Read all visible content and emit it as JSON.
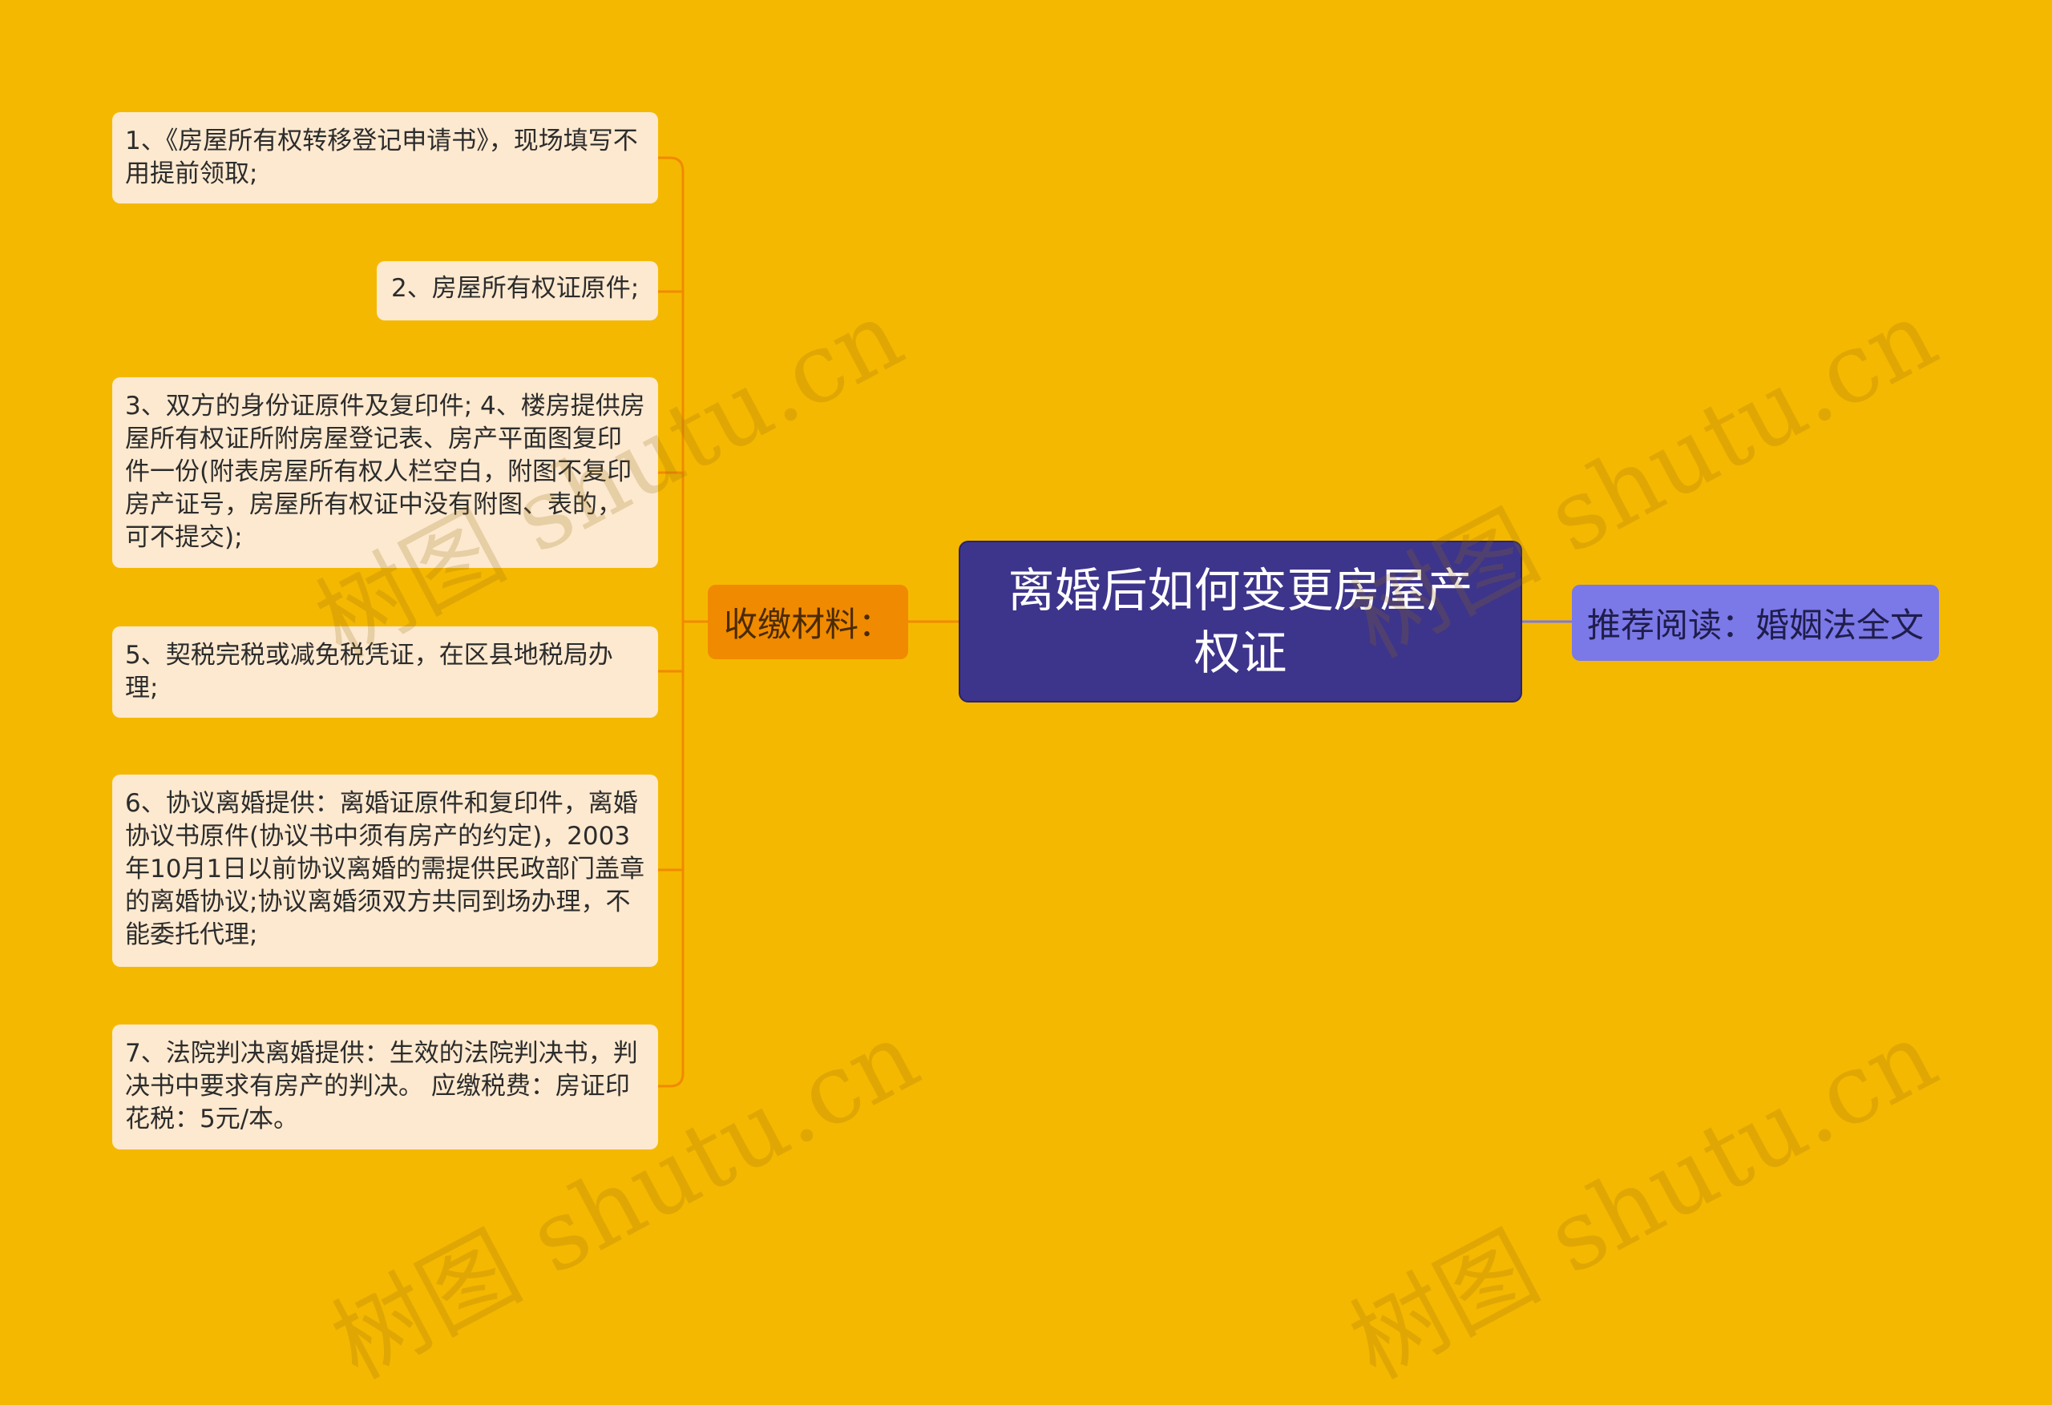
{
  "central_topic": "离婚后如何变更房屋产权证",
  "branch_label": "收缴材料：",
  "recommend_label": "推荐阅读：婚姻法全文",
  "items": [
    "1、《房屋所有权转移登记申请书》，现场填写不用提前领取;",
    "2、房屋所有权证原件;",
    "3、双方的身份证原件及复印件; 4、楼房提供房屋所有权证所附房屋登记表、房产平面图复印件一份(附表房屋所有权人栏空白，附图不复印房产证号，房屋所有权证中没有附图、表的，可不提交);",
    "5、契税完税或减免税凭证，在区县地税局办理;",
    "6、协议离婚提供：离婚证原件和复印件，离婚协议书原件(协议书中须有房产的约定)，2003年10月1日以前协议离婚的需提供民政部门盖章的离婚协议;协议离婚须双方共同到场办理，不能委托代理;",
    "7、法院判决离婚提供：生效的法院判决书，判决书中要求有房产的判决。 应缴税费：房证印花税：5元/本。"
  ],
  "watermark": "树图 shutu.cn",
  "colors": {
    "background": "#F5B800",
    "central": "#3D348B",
    "branch": "#F08A00",
    "recommend": "#7B78E8",
    "leaf": "#FDE9CF",
    "connector": "#F08A00",
    "recommend_connector": "#7B78E8"
  }
}
